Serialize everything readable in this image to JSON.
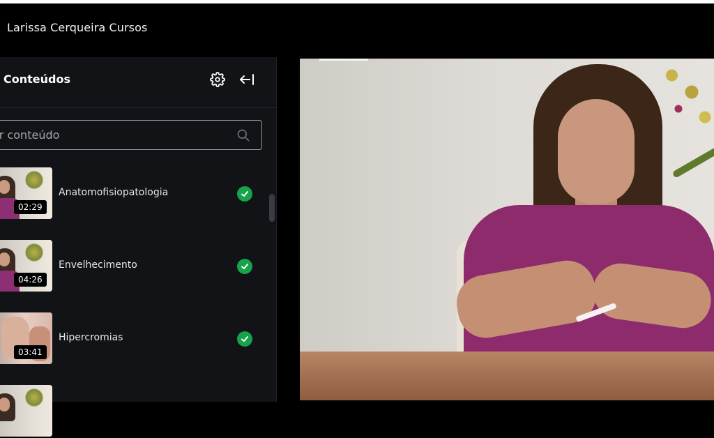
{
  "app": {
    "title": "Larissa Cerqueira Cursos"
  },
  "sidebar": {
    "title": "Conteúdos",
    "search": {
      "placeholder": "ar conteúdo",
      "value": ""
    },
    "items": [
      {
        "label": "Anatomofisiopatologia",
        "duration": "02:29",
        "completed": true
      },
      {
        "label": "Envelhecimento",
        "duration": "04:26",
        "completed": true
      },
      {
        "label": "Hipercromias",
        "duration": "03:41",
        "completed": true
      }
    ]
  },
  "colors": {
    "completed": "#17a34a",
    "sidebar_bg": "#121317",
    "topbar_bg": "#000000"
  },
  "icons": {
    "settings": "gear-icon",
    "collapse": "arrow-left-bar-icon",
    "search": "search-icon",
    "check": "check-icon"
  }
}
